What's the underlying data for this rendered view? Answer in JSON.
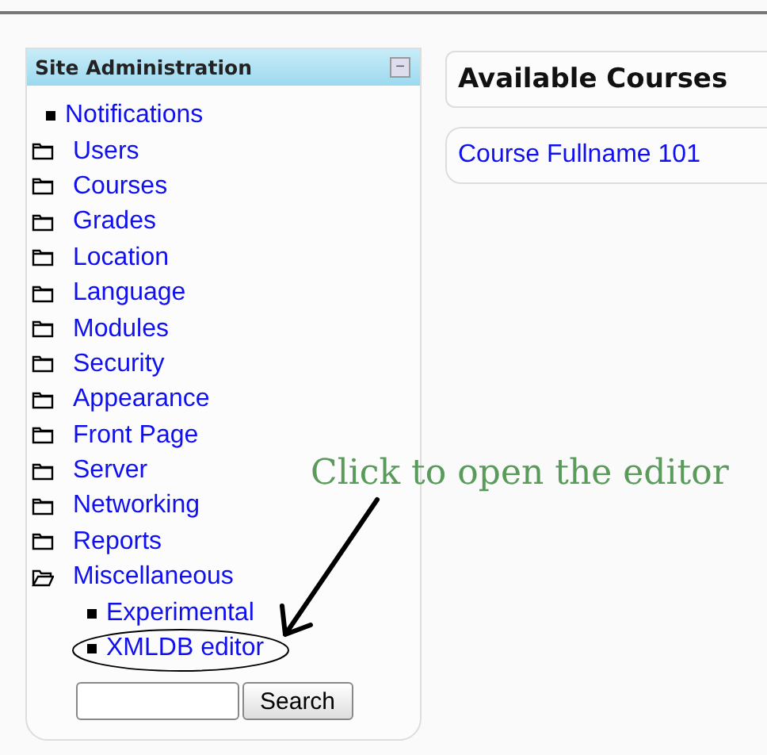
{
  "sidebar": {
    "title": "Site Administration",
    "collapse_button": "−",
    "items": [
      {
        "label": "Notifications",
        "kind": "bullet"
      },
      {
        "label": "Users",
        "kind": "folder",
        "expanded": false
      },
      {
        "label": "Courses",
        "kind": "folder",
        "expanded": false
      },
      {
        "label": "Grades",
        "kind": "folder",
        "expanded": false
      },
      {
        "label": "Location",
        "kind": "folder",
        "expanded": false
      },
      {
        "label": "Language",
        "kind": "folder",
        "expanded": false
      },
      {
        "label": "Modules",
        "kind": "folder",
        "expanded": false
      },
      {
        "label": "Security",
        "kind": "folder",
        "expanded": false
      },
      {
        "label": "Appearance",
        "kind": "folder",
        "expanded": false
      },
      {
        "label": "Front Page",
        "kind": "folder",
        "expanded": false
      },
      {
        "label": "Server",
        "kind": "folder",
        "expanded": false
      },
      {
        "label": "Networking",
        "kind": "folder",
        "expanded": false
      },
      {
        "label": "Reports",
        "kind": "folder",
        "expanded": false
      },
      {
        "label": "Miscellaneous",
        "kind": "folder",
        "expanded": true,
        "children": [
          {
            "label": "Experimental",
            "kind": "bullet"
          },
          {
            "label": "XMLDB editor",
            "kind": "bullet"
          }
        ]
      }
    ],
    "search_button": "Search"
  },
  "main": {
    "heading": "Available Courses",
    "courses": [
      "Course Fullname 101"
    ]
  },
  "annotation": {
    "text": "Click to open the editor"
  }
}
